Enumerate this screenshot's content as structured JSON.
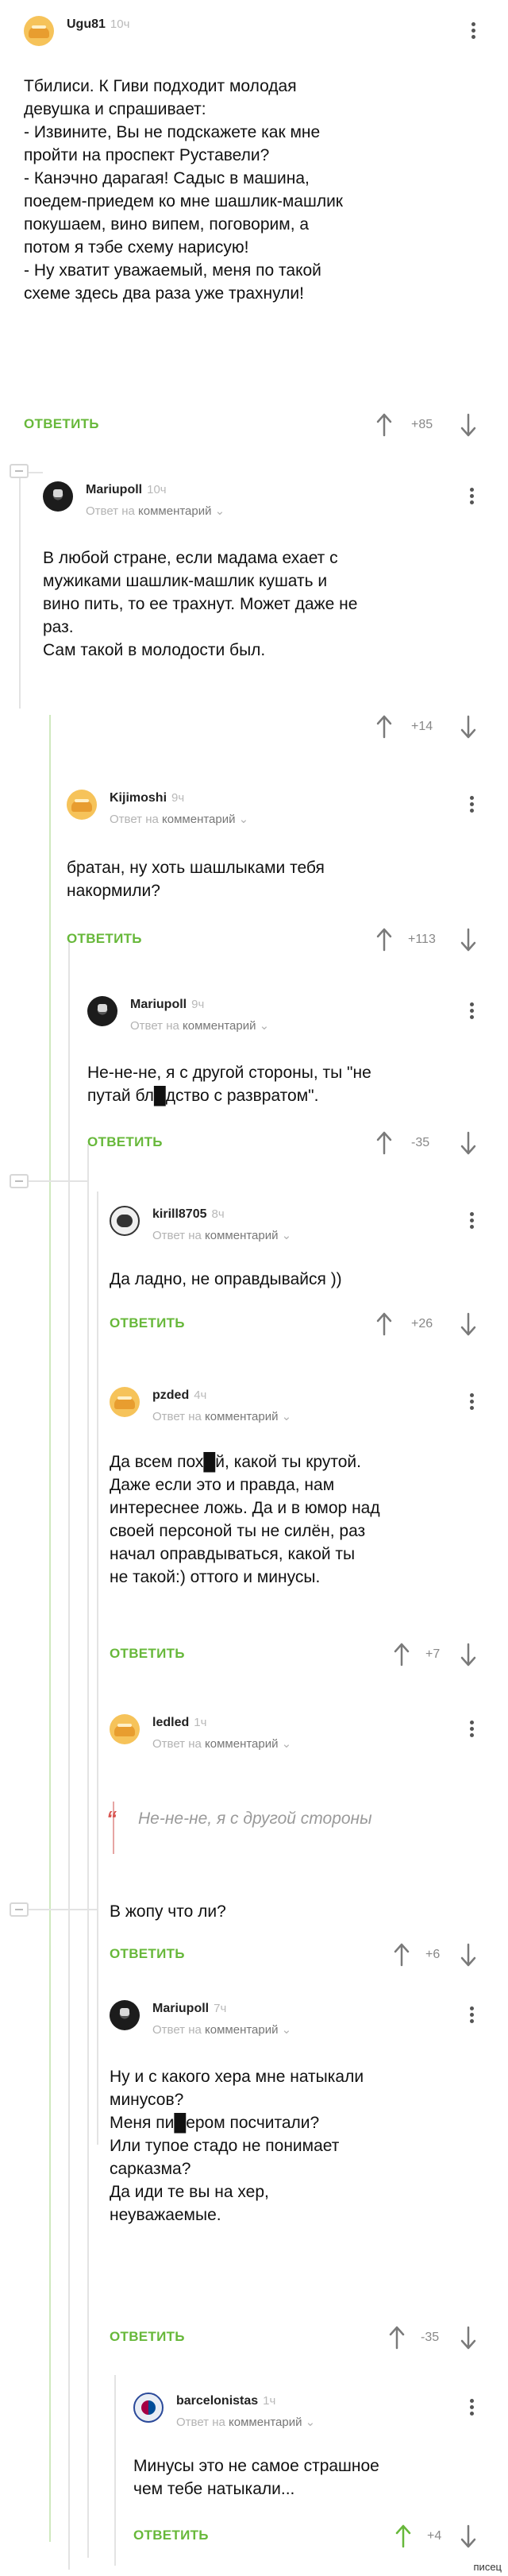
{
  "ui": {
    "reply_label": "ОТВЕТИТЬ",
    "reply_to_prefix": "Ответ на",
    "reply_to_link": "комментарий"
  },
  "comments": [
    {
      "user": "Ugu81",
      "time": "10ч",
      "rating": "+85",
      "is_reply": false,
      "lines": [
        "Тбилиси. К Гиви подходит молодая",
        "девушка и спрашивает:",
        "- Извините, Вы не подскажете как мне",
        "пройти на проспект Руставели?",
        "- Канэчно дарагая! Садыс в машина,",
        "поедем-приедем ко мне шашлик-машлик",
        "покушаем, вино випем, поговорим, а",
        "потом я тэбе схему нарисую!",
        "- Ну хватит уважаемый, меня по такой",
        "схеме здесь два раза уже трахнули!"
      ]
    },
    {
      "user": "Mariupoll",
      "time": "10ч",
      "rating": "+14",
      "is_reply": true,
      "lines": [
        "В любой стране, если мадама ехает с",
        "мужиками шашлик-машлик кушать и",
        "вино пить, то ее трахнут. Может даже не",
        "раз.",
        "Сам такой в молодости был."
      ]
    },
    {
      "user": "Kijimoshi",
      "time": "9ч",
      "rating": "+113",
      "is_reply": true,
      "lines": [
        "братан, ну хоть шашлыками тебя",
        "накормили?"
      ]
    },
    {
      "user": "Mariupoll",
      "time": "9ч",
      "rating": "-35",
      "is_reply": true,
      "lines": [
        "Не-не-не, я с другой стороны, ты \"не",
        "путай бл█дство с развратом\"."
      ]
    },
    {
      "user": "kirill8705",
      "time": "8ч",
      "rating": "+26",
      "is_reply": true,
      "lines": [
        "Да ладно, не оправдывайся ))"
      ]
    },
    {
      "user": "pzded",
      "time": "4ч",
      "rating": "+7",
      "is_reply": true,
      "lines": [
        "Да всем пох█й, какой ты крутой.",
        "Даже если это и правда, нам",
        "интереснее ложь. Да и в юмор над",
        "своей персоной ты не силён, раз",
        "начал оправдываться, какой ты",
        "не такой:) оттого и минусы."
      ]
    },
    {
      "user": "ledled",
      "time": "1ч",
      "rating": "+6",
      "is_reply": true,
      "quote": "Не-не-не, я с другой стороны",
      "lines": [
        "В жопу что ли?"
      ]
    },
    {
      "user": "Mariupoll",
      "time": "7ч",
      "rating": "-35",
      "is_reply": true,
      "lines": [
        "Ну и с какого хера мне натыкали",
        "минусов?",
        "Меня пи█ером посчитали?",
        "Или тупое стадо  не понимает",
        "сарказма?",
        "Да иди те вы на хер,",
        "неуважаемые."
      ]
    },
    {
      "user": "barcelonistas",
      "time": "1ч",
      "rating": "+4",
      "is_reply": true,
      "lines": [
        "Минусы это не самое страшное",
        "чем тебе натыкали..."
      ]
    }
  ],
  "watermark": "писец"
}
